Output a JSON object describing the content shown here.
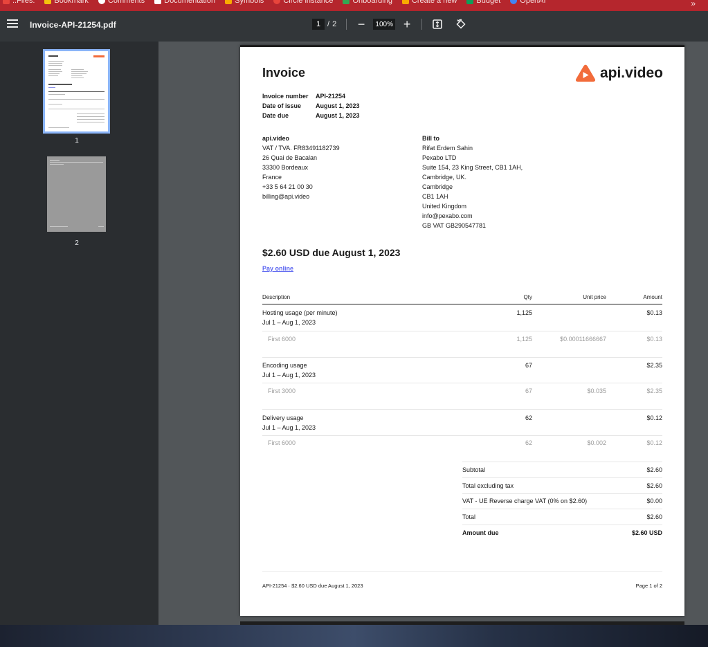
{
  "bookmarks": [
    {
      "label": "..Files:",
      "icon_color": "#e8453c"
    },
    {
      "label": "Bookmark",
      "icon_color": "#f4c20d"
    },
    {
      "label": "Comments",
      "icon_color": "#ffffff"
    },
    {
      "label": "Documentation",
      "icon_color": "#ffffff"
    },
    {
      "label": "Symbols",
      "icon_color": "#f9ab00"
    },
    {
      "label": "Circle instance",
      "icon_color": "#e8453c"
    },
    {
      "label": "Onboarding",
      "icon_color": "#34a853"
    },
    {
      "label": "Create a new",
      "icon_color": "#f9ab00"
    },
    {
      "label": "Budget",
      "icon_color": "#0f9d58"
    },
    {
      "label": "OpenAI",
      "icon_color": "#4285f4"
    }
  ],
  "toolbar": {
    "title": "Invoice-API-21254.pdf",
    "current_page": "1",
    "page_separator": "/",
    "total_pages": "2",
    "zoom_out": "−",
    "zoom_level": "100%",
    "zoom_in": "+"
  },
  "sidebar": {
    "pages": [
      {
        "label": "1"
      },
      {
        "label": "2"
      }
    ]
  },
  "invoice": {
    "title": "Invoice",
    "brand": "api.video",
    "brand_color": "#f26b3a",
    "link_color": "#5a64f0",
    "meta": [
      {
        "label": "Invoice number",
        "value": "API-21254"
      },
      {
        "label": "Date of issue",
        "value": "August 1, 2023"
      },
      {
        "label": "Date due",
        "value": "August 1, 2023"
      }
    ],
    "from": {
      "name": "api.video",
      "lines": [
        "VAT / TVA. FR83491182739",
        "26 Quai de Bacalan",
        "33300 Bordeaux",
        "France",
        "+33 5 64 21 00 30",
        "billing@api.video"
      ]
    },
    "bill_to": {
      "heading": "Bill to",
      "lines": [
        "Rifat Erdem Sahin",
        "Pexabo LTD",
        "Suite 154, 23 King Street, CB1 1AH,",
        "Cambridge, UK.",
        "Cambridge",
        "CB1 1AH",
        "United Kingdom",
        "info@pexabo.com",
        "GB VAT  GB290547781"
      ]
    },
    "due_headline": "$2.60 USD due August 1, 2023",
    "pay_link": "Pay online",
    "table": {
      "headers": {
        "description": "Description",
        "qty": "Qty",
        "unit_price": "Unit price",
        "amount": "Amount"
      },
      "items": [
        {
          "description": "Hosting usage (per minute)",
          "period": "Jul 1 – Aug 1, 2023",
          "qty": "1,125",
          "amount": "$0.13",
          "tier": {
            "description": "First 6000",
            "qty": "1,125",
            "unit_price": "$0.00011666667",
            "amount": "$0.13"
          }
        },
        {
          "description": "Encoding usage",
          "period": "Jul 1 – Aug 1, 2023",
          "qty": "67",
          "amount": "$2.35",
          "tier": {
            "description": "First 3000",
            "qty": "67",
            "unit_price": "$0.035",
            "amount": "$2.35"
          }
        },
        {
          "description": "Delivery usage",
          "period": "Jul 1 – Aug 1, 2023",
          "qty": "62",
          "amount": "$0.12",
          "tier": {
            "description": "First 6000",
            "qty": "62",
            "unit_price": "$0.002",
            "amount": "$0.12"
          }
        }
      ]
    },
    "totals": [
      {
        "label": "Subtotal",
        "value": "$2.60"
      },
      {
        "label": "Total excluding tax",
        "value": "$2.60"
      },
      {
        "label": "VAT - UE Reverse charge VAT (0% on $2.60)",
        "value": "$0.00"
      },
      {
        "label": "Total",
        "value": "$2.60"
      },
      {
        "label": "Amount due",
        "value": "$2.60 USD"
      }
    ],
    "footer": {
      "left": "API-21254 · $2.60 USD due August 1, 2023",
      "right": "Page 1 of 2"
    }
  }
}
